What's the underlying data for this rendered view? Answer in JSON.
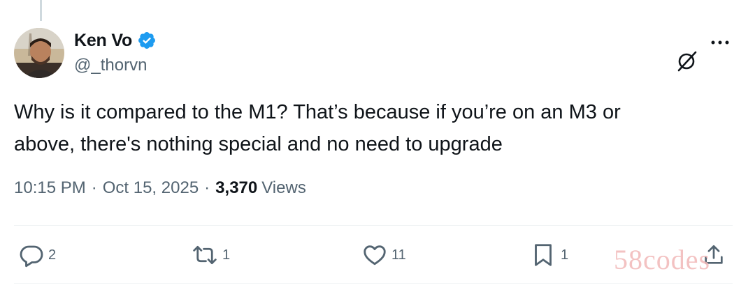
{
  "author": {
    "display_name": "Ken Vo",
    "handle": "@_thorvn",
    "verified": true,
    "verified_color": "#1d9bf0"
  },
  "tweet": {
    "text": "Why is it compared to the M1? That’s because if you’re on an M3 or\nabove, there's nothing special and no need to upgrade",
    "time": "10:15 PM",
    "date": "Oct 15, 2025",
    "separator": "·",
    "views_count": "3,370",
    "views_label": "Views"
  },
  "actions": {
    "reply": {
      "icon": "reply-icon",
      "count": "2"
    },
    "repost": {
      "icon": "repost-icon",
      "count": "1"
    },
    "like": {
      "icon": "heart-icon",
      "count": "11"
    },
    "bookmark": {
      "icon": "bookmark-icon",
      "count": "1"
    },
    "share": {
      "icon": "share-icon"
    }
  },
  "header_icons": [
    "grok-icon",
    "more-icon"
  ],
  "watermark": "58codes",
  "colors": {
    "text_primary": "#0f1419",
    "text_secondary": "#536471",
    "divider": "#eff3f4",
    "accent": "#1d9bf0"
  }
}
